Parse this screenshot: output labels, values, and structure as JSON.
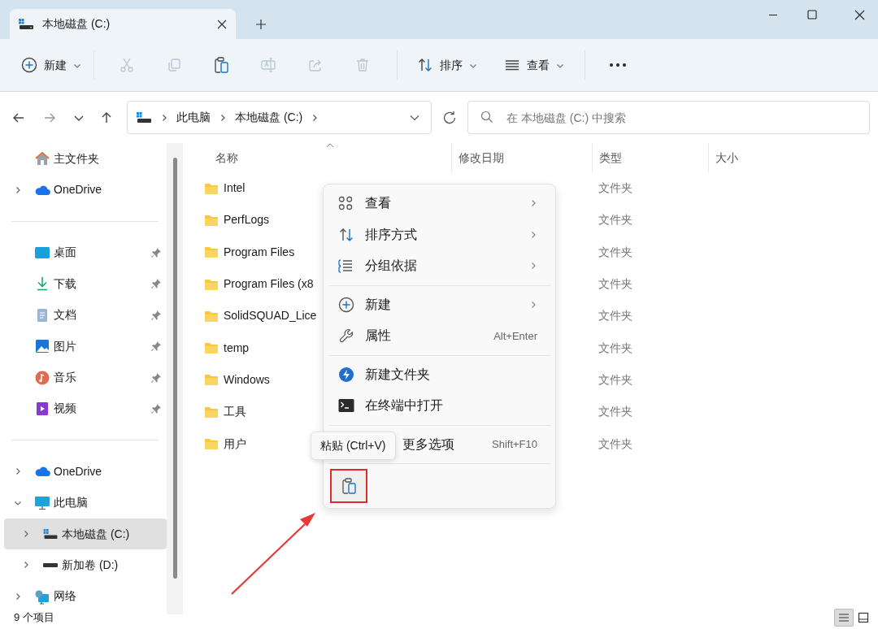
{
  "window": {
    "tab_title": "本地磁盘 (C:)"
  },
  "toolbar": {
    "items": [
      {
        "kind": "new",
        "label": "新建",
        "disabled": false
      },
      {
        "kind": "cut",
        "disabled": true
      },
      {
        "kind": "copy",
        "disabled": true
      },
      {
        "kind": "paste",
        "disabled": false
      },
      {
        "kind": "rename",
        "disabled": true
      },
      {
        "kind": "share",
        "disabled": true
      },
      {
        "kind": "delete",
        "disabled": true
      },
      {
        "kind": "sort",
        "label": "排序",
        "disabled": false
      },
      {
        "kind": "view",
        "label": "查看",
        "disabled": false
      },
      {
        "kind": "more",
        "disabled": false
      }
    ]
  },
  "address_bar": {
    "breadcrumbs": [
      "此电脑",
      "本地磁盘 (C:)"
    ]
  },
  "search": {
    "placeholder": "在 本地磁盘 (C:) 中搜索"
  },
  "sidebar": {
    "groups": [
      [
        {
          "label": "主文件夹",
          "selected": false,
          "pinned": false
        },
        {
          "label": "OneDrive",
          "expanded": false,
          "selected": false,
          "pinned": false
        }
      ],
      [
        {
          "label": "桌面",
          "selected": false,
          "pinned": true
        },
        {
          "label": "下载",
          "selected": false,
          "pinned": true
        },
        {
          "label": "文档",
          "selected": false,
          "pinned": true
        },
        {
          "label": "图片",
          "selected": false,
          "pinned": true
        },
        {
          "label": "音乐",
          "selected": false,
          "pinned": true
        },
        {
          "label": "视频",
          "selected": false,
          "pinned": true
        }
      ],
      [
        {
          "label": "OneDrive",
          "expanded": false,
          "selected": false,
          "pinned": false
        },
        {
          "label": "此电脑",
          "expanded": true,
          "selected": false,
          "pinned": false,
          "children": [
            {
              "label": "本地磁盘 (C:)",
              "expanded": false,
              "selected": true,
              "pinned": false
            },
            {
              "label": "新加卷 (D:)",
              "expanded": false,
              "selected": false,
              "pinned": false
            }
          ]
        },
        {
          "label": "网络",
          "expanded": false,
          "selected": false,
          "pinned": false
        }
      ]
    ]
  },
  "table": {
    "columns": [
      "名称",
      "修改日期",
      "类型",
      "大小"
    ],
    "rows": [
      {
        "name": "Intel",
        "type": "文件夹"
      },
      {
        "name": "PerfLogs",
        "type": "文件夹"
      },
      {
        "name": "Program Files",
        "type": "文件夹"
      },
      {
        "name": "Program Files (x8",
        "type": "文件夹"
      },
      {
        "name": "SolidSQUAD_Lice",
        "type": "文件夹"
      },
      {
        "name": "temp",
        "type": "文件夹"
      },
      {
        "name": "Windows",
        "type": "文件夹"
      },
      {
        "name": "工具",
        "type": "文件夹"
      },
      {
        "name": "用户",
        "type": "文件夹"
      }
    ]
  },
  "context_menu": {
    "groups": [
      [
        {
          "label": "查看",
          "submenu": true
        },
        {
          "label": "排序方式",
          "submenu": true
        },
        {
          "label": "分组依据",
          "submenu": true
        }
      ],
      [
        {
          "label": "新建",
          "submenu": true
        },
        {
          "label": "属性",
          "shortcut": "Alt+Enter",
          "submenu": false
        }
      ],
      [
        {
          "label": "新建文件夹",
          "submenu": false
        },
        {
          "label": "在终端中打开",
          "submenu": false
        }
      ],
      [
        {
          "label": "更多选项",
          "shortcut": "Shift+F10",
          "submenu": false
        }
      ]
    ],
    "bottom_actions": [
      {
        "kind": "paste",
        "highlighted": true
      }
    ]
  },
  "tooltip": "粘贴 (Ctrl+V)",
  "status_bar": {
    "item_count": "9 个项目",
    "view_buttons": [
      {
        "kind": "details",
        "selected": true
      },
      {
        "kind": "tiles",
        "selected": false
      }
    ]
  }
}
